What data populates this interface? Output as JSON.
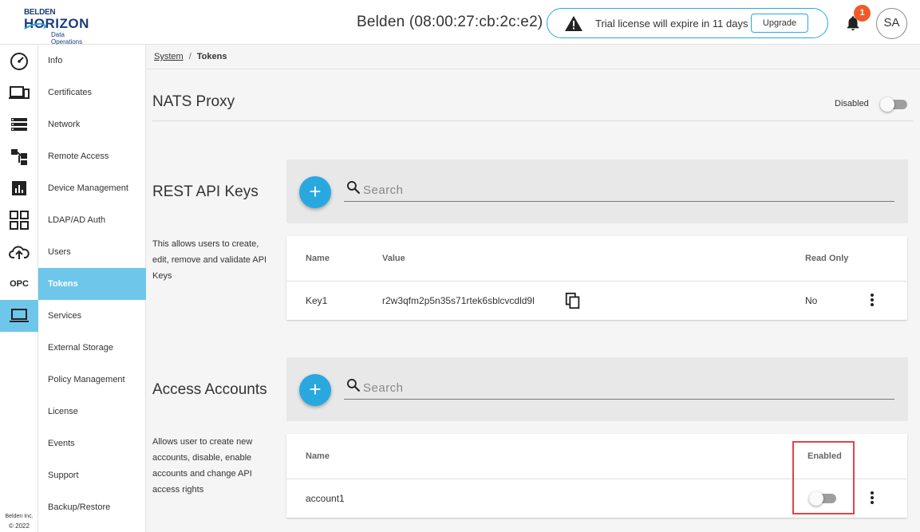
{
  "header": {
    "logo_line1": "BELDEN",
    "logo_line2": "HORIZON",
    "logo_line3": "Data Operations",
    "device_title": "Belden (08:00:27:cb:2c:e2)",
    "trial_message": "Trial license will expire in 11 days",
    "upgrade_label": "Upgrade",
    "notification_count": "1",
    "avatar_initials": "SA"
  },
  "rail": {
    "opc_label": "OPC",
    "footer_company": "Belden Inc.",
    "footer_copyright": "© 2022",
    "icons": [
      "dashboard-icon",
      "devices-icon",
      "storage-icon",
      "hierarchy-icon",
      "analytics-icon",
      "apps-grid-icon",
      "cloud-upload-icon",
      "opc-icon",
      "system-laptop-icon"
    ],
    "active": "system-laptop-icon"
  },
  "subnav": {
    "items": [
      "Info",
      "Certificates",
      "Network",
      "Remote Access",
      "Device Management",
      "LDAP/AD Auth",
      "Users",
      "Tokens",
      "Services",
      "External Storage",
      "Policy Management",
      "License",
      "Events",
      "Support",
      "Backup/Restore"
    ],
    "active": "Tokens"
  },
  "breadcrumb": {
    "parent": "System",
    "separator": "/",
    "current": "Tokens"
  },
  "nats": {
    "title": "NATS Proxy",
    "toggle_label": "Disabled",
    "enabled": false
  },
  "rest_api": {
    "title": "REST API Keys",
    "description": "This allows users to create, edit, remove and validate API Keys",
    "add_label": "+",
    "search_placeholder": "Search",
    "columns": [
      "Name",
      "Value",
      "Read Only"
    ],
    "rows": [
      {
        "name": "Key1",
        "value": "r2w3qfm2p5n35s71rtek6sblcvcdld9l",
        "read_only": "No"
      }
    ]
  },
  "access_accounts": {
    "title": "Access Accounts",
    "description": "Allows user to create new accounts, disable, enable accounts and change API access rights",
    "add_label": "+",
    "search_placeholder": "Search",
    "columns": [
      "Name",
      "Enabled"
    ],
    "rows": [
      {
        "name": "account1",
        "enabled": false
      }
    ]
  },
  "colors": {
    "accent": "#29a8e0",
    "active_nav": "#6ec6ea",
    "badge": "#f05a28",
    "highlight": "#e04545"
  }
}
